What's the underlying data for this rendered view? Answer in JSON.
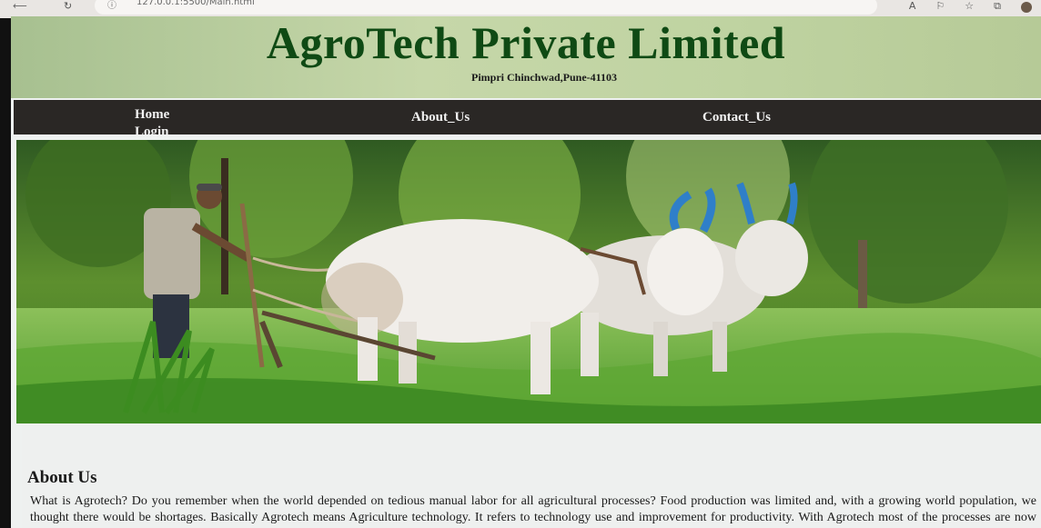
{
  "browser": {
    "url": "127.0.0.1:5500/Main.html",
    "read_aloud": "A",
    "toolbar_icons": [
      "read-aloud-icon",
      "tracking-icon",
      "favorites-icon",
      "collections-icon",
      "profile-avatar"
    ]
  },
  "header": {
    "title": "AgroTech Private Limited",
    "address": "Pimpri Chinchwad,Pune-41103"
  },
  "nav": {
    "home": "Home",
    "login": "Login",
    "about": "About_Us",
    "contact": "Contact_Us"
  },
  "about": {
    "heading": "About Us",
    "body": "What is Agrotech? Do you remember when the world depended on tedious manual labor for all agricultural processes? Food production was limited and, with a growing world population, we thought there would be shortages. Basically Agrotech means Agriculture technology. It refers to technology use and improvement for productivity. With Agrotech most of the processes are now done by technology."
  },
  "colors": {
    "title_green": "#0f4a14",
    "header_bg": "#bfd3a1",
    "nav_bg": "#2a2725"
  }
}
